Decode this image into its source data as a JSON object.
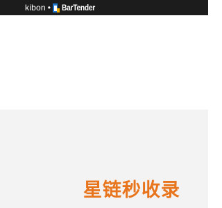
{
  "header": {
    "brand_left": "kibon",
    "separator": "•",
    "brand_right": "BarTender",
    "brand_icon": "bartender-logo-icon",
    "background_color": "#1c1c1c"
  },
  "footer": {
    "text": "星链秒收录",
    "color": "#e8741c"
  },
  "colors": {
    "body_background": "#ffffff",
    "lower_background": "#f3f3f3"
  }
}
